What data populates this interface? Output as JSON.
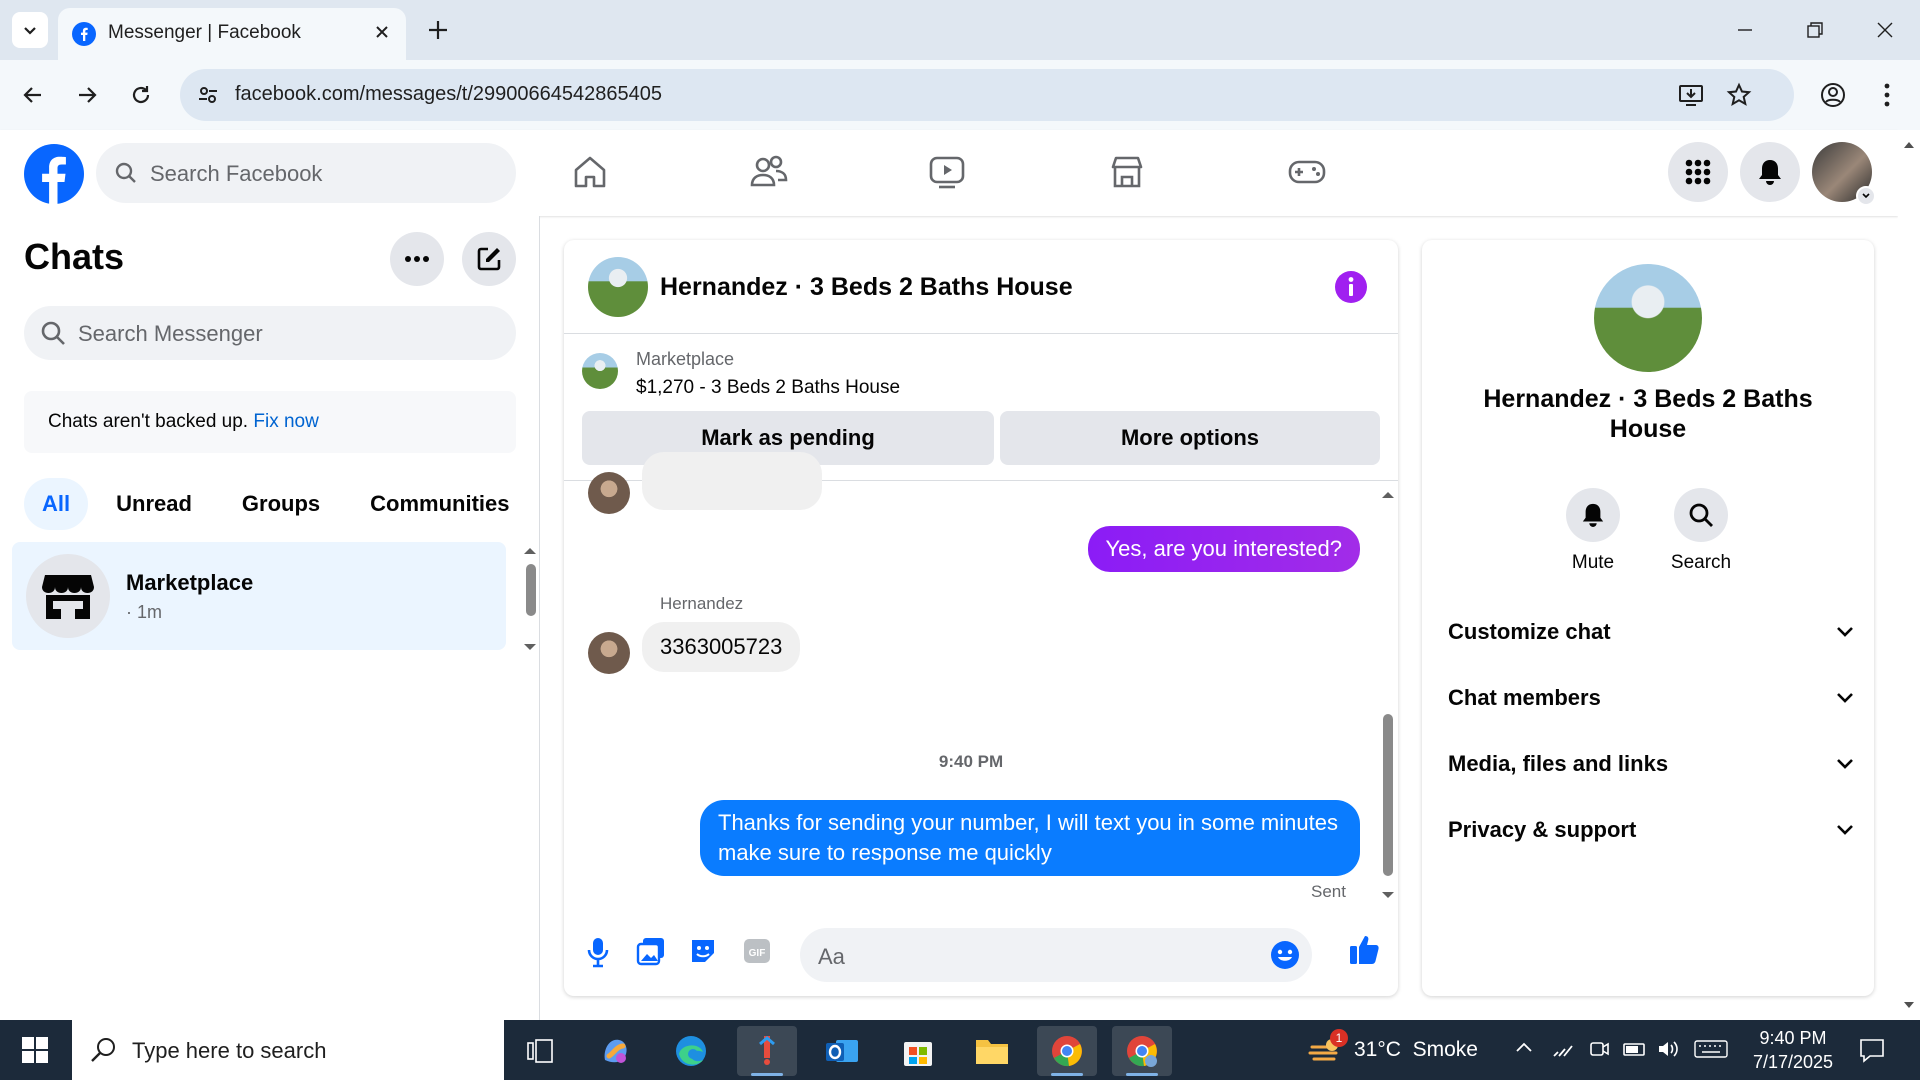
{
  "browser": {
    "tab_title": "Messenger | Facebook",
    "url": "facebook.com/messages/t/29900664542865405"
  },
  "fb": {
    "search_placeholder": "Search Facebook",
    "brand_color": "#0866ff"
  },
  "left": {
    "title": "Chats",
    "search_placeholder": "Search Messenger",
    "backup_text": "Chats aren't backed up.",
    "backup_link": "Fix now",
    "tabs": [
      "All",
      "Unread",
      "Groups",
      "Communities"
    ],
    "conversations": [
      {
        "name": "Marketplace",
        "meta": "· 1m"
      }
    ]
  },
  "conversation": {
    "title": "Hernandez · 3 Beds 2 Baths House",
    "marketplace_label": "Marketplace",
    "listing": "$1,270 - 3 Beds 2 Baths House",
    "mark_pending": "Mark as pending",
    "more_options": "More options",
    "messages": [
      {
        "from": "me",
        "text": "Yes, are you interested?"
      },
      {
        "from": "Hernandez",
        "sender_label": "Hernandez",
        "text": "3363005723"
      },
      {
        "time": "9:40 PM"
      },
      {
        "from": "me",
        "text": "Thanks for sending your number, I will text you in some minutes make sure to response me quickly",
        "status": "Sent"
      }
    ],
    "composer_placeholder": "Aa"
  },
  "right": {
    "title": "Hernandez · 3 Beds 2 Baths House",
    "mute": "Mute",
    "search": "Search",
    "sections": [
      "Customize chat",
      "Chat members",
      "Media, files and links",
      "Privacy & support"
    ]
  },
  "taskbar": {
    "search_placeholder": "Type here to search",
    "weather": "31°C  Smoke",
    "weather_badge": "1",
    "time": "9:40 PM",
    "date": "7/17/2025"
  }
}
